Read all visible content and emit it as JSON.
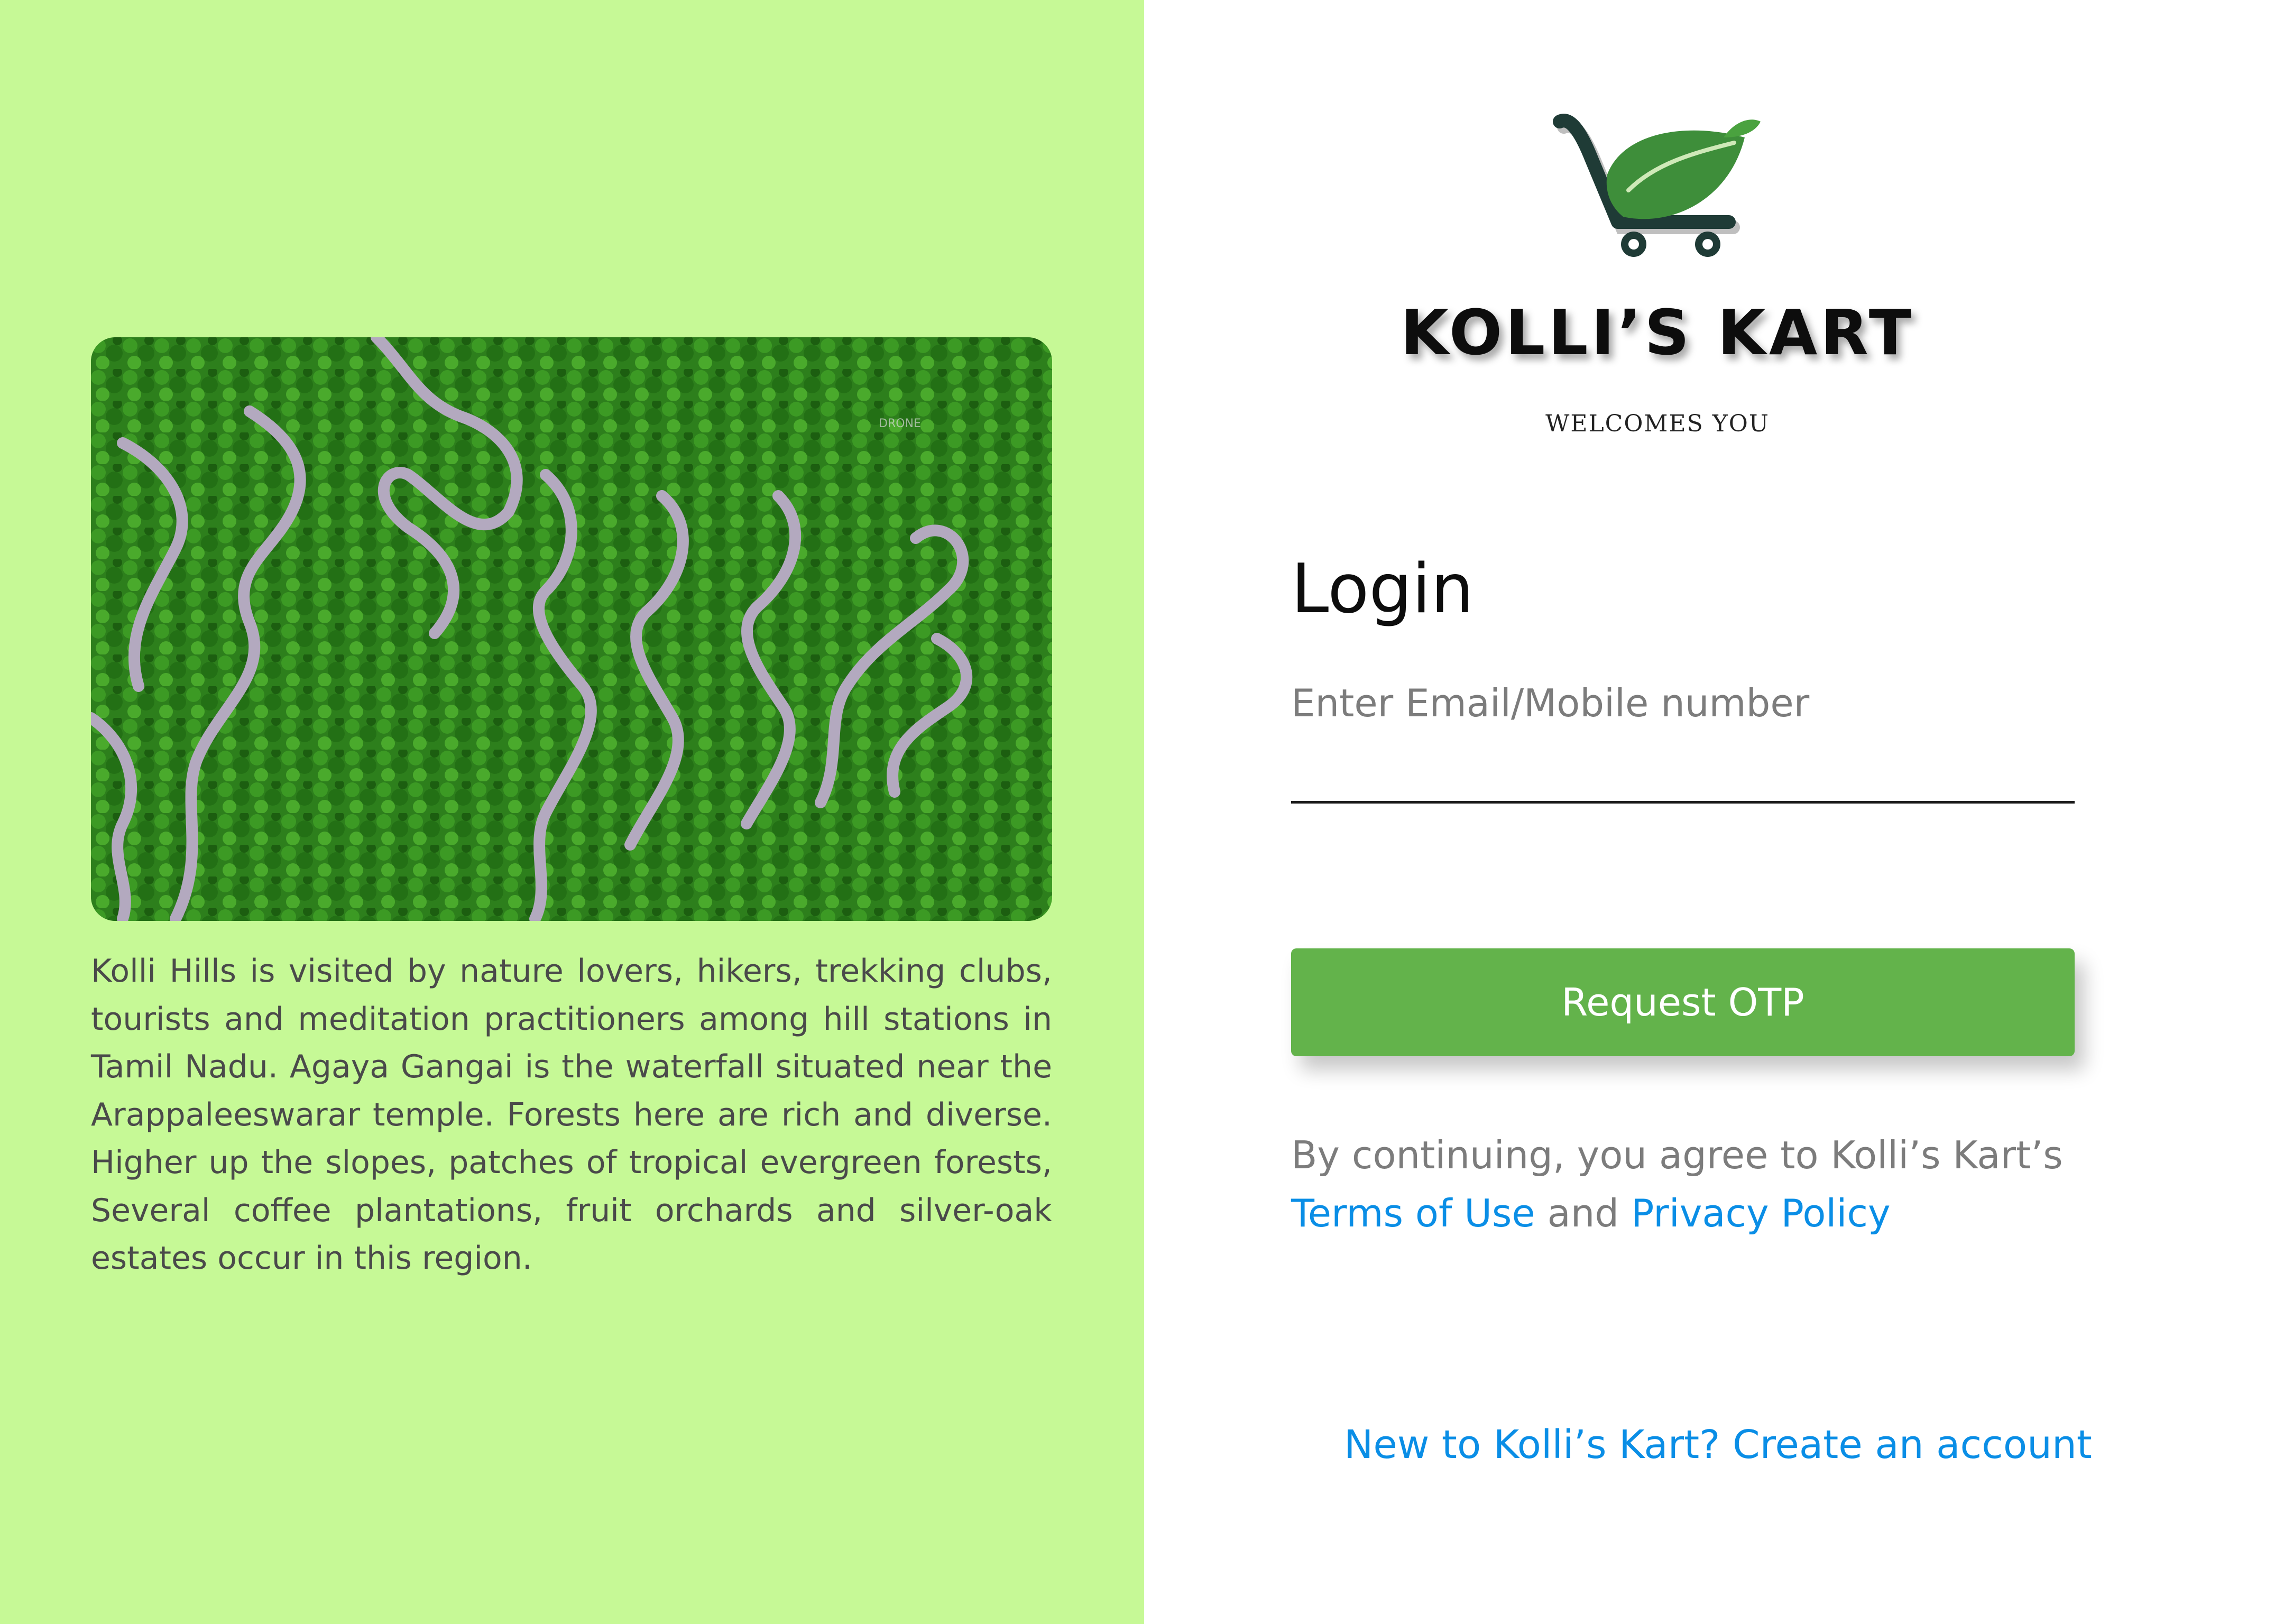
{
  "left_panel": {
    "image": {
      "alt": "Aerial view of Kolli Hills hairpin bends",
      "watermark": "DRONE"
    },
    "description": "Kolli Hills is visited by nature lovers, hikers, trekking clubs, tourists and meditation practitioners among hill stations in Tamil Nadu. Agaya Gangai is the waterfall situated near the Arappaleeswarar temple. Forests here are rich and diverse. Higher up the slopes, patches of tropical evergreen forests, Several coffee plantations, fruit orchards and silver-oak estates occur in this region."
  },
  "brand": {
    "name": "KOLLI’S KART",
    "tagline": "WELCOMES YOU",
    "logo_icon": "leaf-cart-icon"
  },
  "login": {
    "title": "Login",
    "email_label": "Enter Email/Mobile number",
    "email_value": "",
    "request_otp_label": "Request OTP",
    "consent_prefix": "By continuing, you agree to Kolli’s Kart’s",
    "terms_label": "Terms of Use",
    "and_label": " and ",
    "privacy_label": "Privacy Policy",
    "signup_label": "New to Kolli’s Kart? Create an account"
  },
  "colors": {
    "left_background": "#c6f996",
    "button_green": "#63b34b",
    "link_blue": "#0a8ee6",
    "muted_text": "#7c7c7c"
  }
}
